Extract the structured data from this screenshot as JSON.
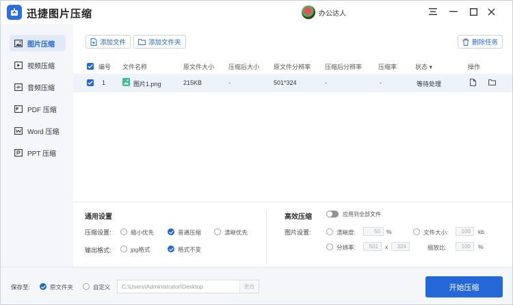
{
  "app": {
    "title": "迅捷图片压缩",
    "username": "办公达人",
    "controls": [
      "menu-icon",
      "minimize-icon",
      "maximize-icon",
      "close-icon"
    ]
  },
  "sidebar": {
    "items": [
      {
        "label": "图片压缩",
        "icon": "image-icon",
        "active": true
      },
      {
        "label": "视频压缩",
        "icon": "video-icon",
        "active": false
      },
      {
        "label": "音频压缩",
        "icon": "audio-icon",
        "active": false
      },
      {
        "label": "PDF 压缩",
        "icon": "pdf-icon",
        "active": false
      },
      {
        "label": "Word 压缩",
        "icon": "word-icon",
        "active": false
      },
      {
        "label": "PPT 压缩",
        "icon": "ppt-icon",
        "active": false
      }
    ]
  },
  "toolbar": {
    "add_file": "添加文件",
    "add_folder": "添加文件夹",
    "delete_task": "删除任务"
  },
  "table": {
    "headers": {
      "index": "编号",
      "name": "文件名称",
      "orig_size": "原文件大小",
      "comp_size": "压缩后大小",
      "orig_res": "原文件分辨率",
      "comp_res": "压缩后分辨率",
      "ratio": "压缩率",
      "status": "状态",
      "actions": "操作"
    },
    "rows": [
      {
        "index": "1",
        "name": "图片1.png",
        "orig_size": "215KB",
        "comp_size": "-",
        "orig_res": "501*324",
        "comp_res": "-",
        "ratio": "-",
        "status": "等待处理"
      }
    ]
  },
  "general": {
    "title": "通用设置",
    "compress_label": "压缩设置:",
    "compress_options": [
      "缩小优先",
      "普通压缩",
      "清晰优先"
    ],
    "compress_selected": "普通压缩",
    "format_label": "输出格式:",
    "format_options": [
      "jpg格式",
      "格式不变"
    ],
    "format_selected": "格式不变"
  },
  "advanced": {
    "title": "高效压缩",
    "apply_all": "应用到全部文件",
    "image_settings_label": "图片设置:",
    "clarity_label": "清晰度:",
    "clarity_value": "50",
    "clarity_unit": "%",
    "filesize_label": "文件大小:",
    "filesize_value": "100",
    "filesize_unit": "kb",
    "resolution_label": "分辨率:",
    "res_width": "501",
    "res_x": "x",
    "res_height": "324",
    "scale_label": "缩放比:",
    "scale_value": "100",
    "scale_unit": "%"
  },
  "bottom": {
    "save_to": "保存至:",
    "source_folder": "原文件夹",
    "custom": "自定义",
    "path": "C:\\Users\\Administrator\\Desktop",
    "change": "更改",
    "start": "开始压缩"
  },
  "colors": {
    "accent": "#2467d8",
    "sidebar_bg": "#f4f6fa",
    "row_bg": "#eef2fa"
  }
}
